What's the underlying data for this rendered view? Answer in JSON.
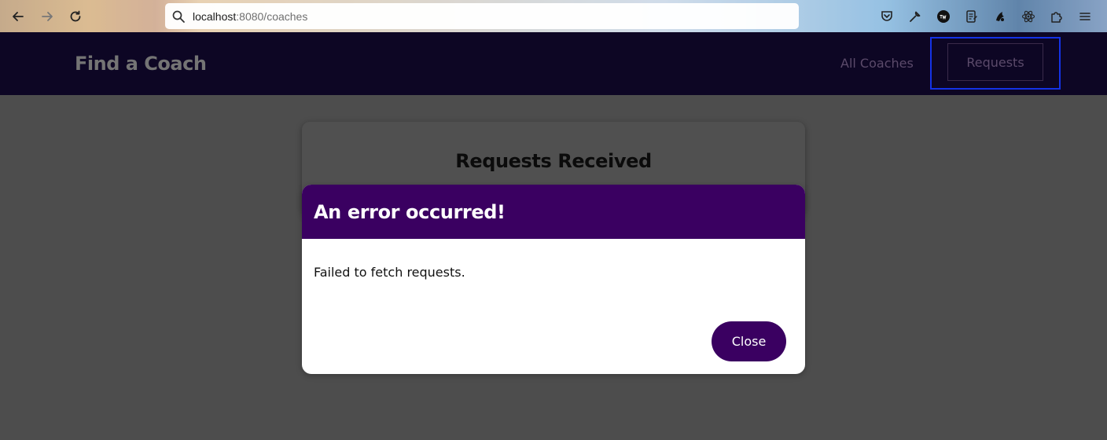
{
  "browser": {
    "url_host": "localhost",
    "url_rest": ":8080/coaches"
  },
  "header": {
    "brand": "Find a Coach",
    "nav": {
      "all_coaches": "All Coaches",
      "requests": "Requests"
    }
  },
  "page": {
    "card_title": "Requests Received"
  },
  "dialog": {
    "title": "An error occurred!",
    "message": "Failed to fetch requests.",
    "close_label": "Close"
  },
  "colors": {
    "header_bg": "#0d0624",
    "dialog_accent": "#3a0061",
    "focus_ring": "#1432e6",
    "backdrop": "#4d4d4d"
  },
  "icons": {
    "back": "arrow-left-icon",
    "forward": "arrow-right-icon",
    "reload": "reload-icon",
    "search": "search-icon",
    "pocket": "pocket-icon",
    "tools": "wrench-icon",
    "extension_twd": "twd-extension-icon",
    "reader": "reader-icon",
    "extension_paw": "paw-extension-icon",
    "react": "react-devtools-icon",
    "extensions": "puzzle-icon",
    "menu": "hamburger-menu-icon"
  }
}
